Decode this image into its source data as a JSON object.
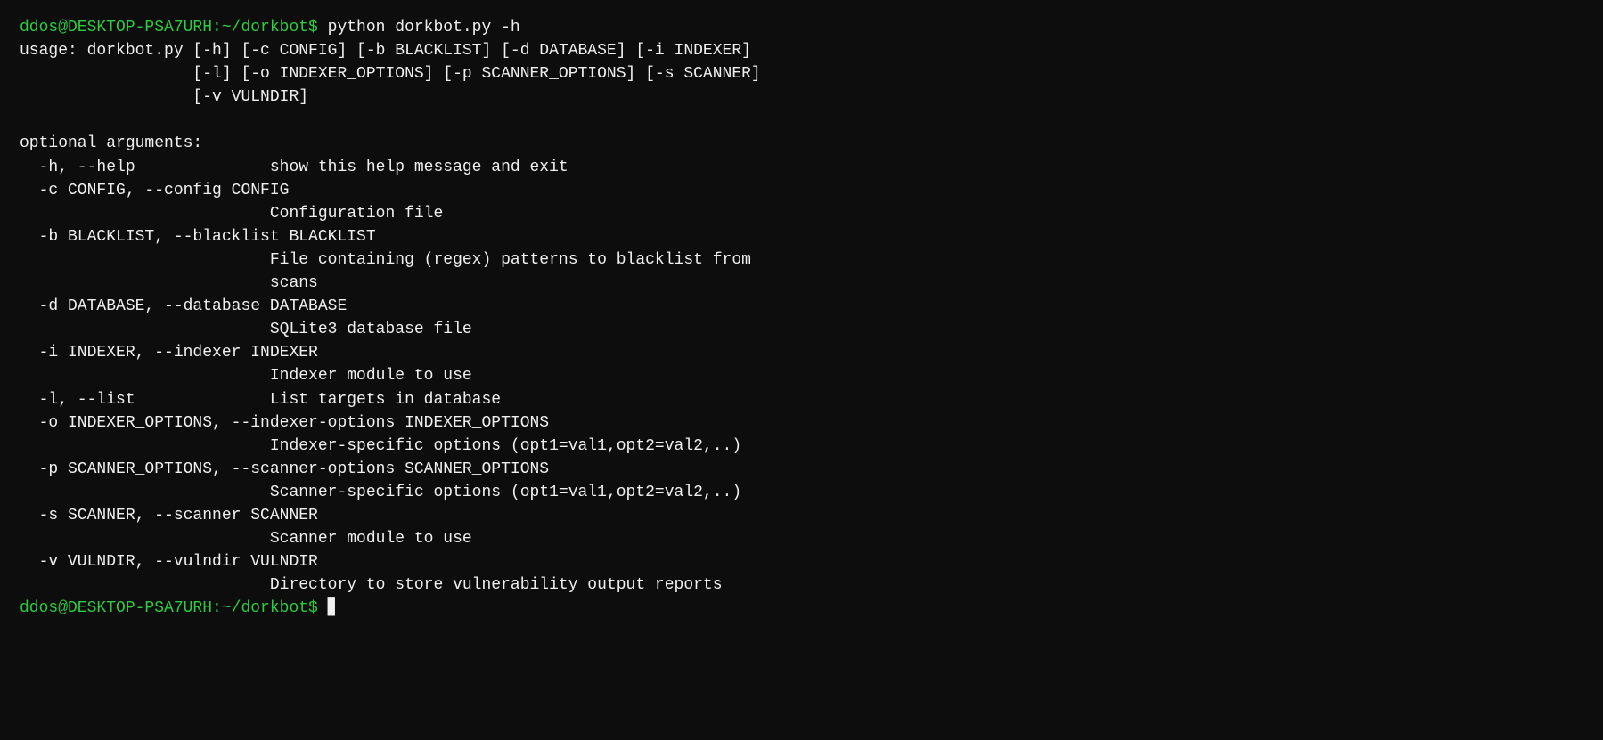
{
  "terminal": {
    "lines": [
      {
        "type": "prompt_command",
        "prompt": "ddos@DESKTOP-PSA7URH:~/dorkbot$ ",
        "command": "python dorkbot.py -h"
      },
      {
        "type": "output",
        "text": "usage: dorkbot.py [-h] [-c CONFIG] [-b BLACKLIST] [-d DATABASE] [-i INDEXER]"
      },
      {
        "type": "output",
        "text": "                  [-l] [-o INDEXER_OPTIONS] [-p SCANNER_OPTIONS] [-s SCANNER]"
      },
      {
        "type": "output",
        "text": "                  [-v VULNDIR]"
      },
      {
        "type": "blank"
      },
      {
        "type": "output",
        "text": "optional arguments:"
      },
      {
        "type": "output",
        "text": "  -h, --help              show this help message and exit"
      },
      {
        "type": "output",
        "text": "  -c CONFIG, --config CONFIG"
      },
      {
        "type": "output",
        "text": "                          Configuration file"
      },
      {
        "type": "output",
        "text": "  -b BLACKLIST, --blacklist BLACKLIST"
      },
      {
        "type": "output",
        "text": "                          File containing (regex) patterns to blacklist from"
      },
      {
        "type": "output",
        "text": "                          scans"
      },
      {
        "type": "output",
        "text": "  -d DATABASE, --database DATABASE"
      },
      {
        "type": "output",
        "text": "                          SQLite3 database file"
      },
      {
        "type": "output",
        "text": "  -i INDEXER, --indexer INDEXER"
      },
      {
        "type": "output",
        "text": "                          Indexer module to use"
      },
      {
        "type": "output",
        "text": "  -l, --list              List targets in database"
      },
      {
        "type": "output",
        "text": "  -o INDEXER_OPTIONS, --indexer-options INDEXER_OPTIONS"
      },
      {
        "type": "output",
        "text": "                          Indexer-specific options (opt1=val1,opt2=val2,..)"
      },
      {
        "type": "output",
        "text": "  -p SCANNER_OPTIONS, --scanner-options SCANNER_OPTIONS"
      },
      {
        "type": "output",
        "text": "                          Scanner-specific options (opt1=val1,opt2=val2,..)"
      },
      {
        "type": "output",
        "text": "  -s SCANNER, --scanner SCANNER"
      },
      {
        "type": "output",
        "text": "                          Scanner module to use"
      },
      {
        "type": "output",
        "text": "  -v VULNDIR, --vulndir VULNDIR"
      },
      {
        "type": "output",
        "text": "                          Directory to store vulnerability output reports"
      },
      {
        "type": "prompt_only",
        "prompt": "ddos@DESKTOP-PSA7URH:~/dorkbot$ "
      }
    ],
    "prompt_color": "#2ecc40",
    "output_color": "#f0f0f0"
  }
}
